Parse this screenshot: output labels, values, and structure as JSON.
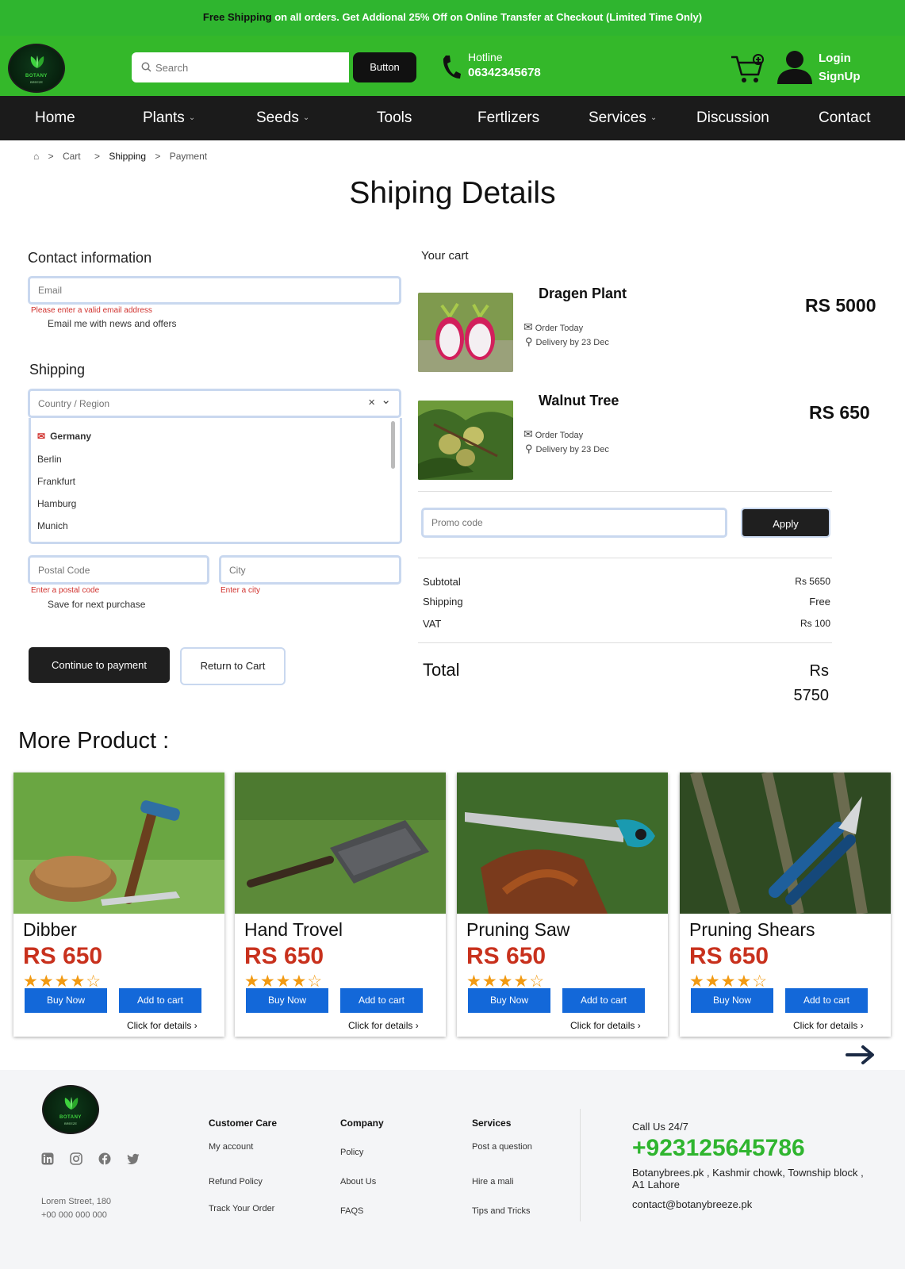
{
  "banner": {
    "highlight": "Free Shipping",
    "text": " on all orders. Get Addional 25% Off on Online Transfer at Checkout (Limited Time Only)"
  },
  "header": {
    "logo_text": "BOTANY",
    "logo_sub": "BREEZE",
    "search_placeholder": "Search",
    "search_button": "Button",
    "hotline_label": "Hotline",
    "hotline_number": "06342345678",
    "login": "Login",
    "signup": "SignUp"
  },
  "nav": {
    "items": [
      {
        "label": "Home"
      },
      {
        "label": "Plants",
        "dropdown": true
      },
      {
        "label": "Seeds",
        "dropdown": true
      },
      {
        "label": "Tools"
      },
      {
        "label": "Fertlizers"
      },
      {
        "label": "Services",
        "dropdown": true
      },
      {
        "label": "Discussion"
      },
      {
        "label": "Contact"
      }
    ]
  },
  "breadcrumb": [
    "Cart",
    "Shipping",
    "Payment"
  ],
  "page_title": "Shiping Details",
  "contact": {
    "heading": "Contact information",
    "email_placeholder": "Email",
    "email_error": "Please enter a valid email address",
    "newsletter_label": "Email me with news and offers"
  },
  "shipping": {
    "heading": "Shipping",
    "country_placeholder": "Country / Region",
    "dropdown_country": "Germany",
    "dropdown_cities": [
      "Berlin",
      "Frankfurt",
      "Hamburg",
      "Munich"
    ],
    "postal_placeholder": "Postal Code",
    "postal_error": "Enter a postal code",
    "city_placeholder": "City",
    "city_error": "Enter a city",
    "save_label": "Save for next purchase",
    "continue_button": "Continue to payment",
    "return_button": "Return to Cart"
  },
  "cart": {
    "heading": "Your cart",
    "items": [
      {
        "name": "Dragen Plant",
        "price": "RS 5000",
        "order": "Order Today",
        "delivery": "Delivery by 23 Dec"
      },
      {
        "name": "Walnut Tree",
        "price": "RS 650",
        "order": "Order Today",
        "delivery": "Delivery by 23 Dec"
      }
    ],
    "promo_placeholder": "Promo code",
    "apply_button": "Apply",
    "summary": [
      {
        "label": "Subtotal",
        "value": "Rs 5650"
      },
      {
        "label": "Shipping",
        "value": "Free"
      },
      {
        "label": "VAT",
        "value": "Rs 100"
      }
    ],
    "total_label": "Total",
    "total_currency": "Rs",
    "total_value": "5750"
  },
  "more": {
    "title": "More Product :",
    "products": [
      {
        "name": "Dibber",
        "price": "RS 650",
        "rating": 4,
        "stars": "★★★★☆",
        "buy": "Buy Now",
        "add": "Add to cart",
        "details": "Click for details"
      },
      {
        "name": "Hand Trovel",
        "price": "RS 650",
        "rating": 4,
        "stars": "★★★★☆",
        "buy": "Buy Now",
        "add": "Add to cart",
        "details": "Click for details"
      },
      {
        "name": "Pruning Saw",
        "price": "RS 650",
        "rating": 4,
        "stars": "★★★★☆",
        "buy": "Buy Now",
        "add": "Add to cart",
        "details": "Click for details"
      },
      {
        "name": "Pruning Shears",
        "price": "RS 650",
        "rating": 4,
        "stars": "★★★★☆",
        "buy": "Buy Now",
        "add": "Add to cart",
        "details": "Click for details"
      }
    ]
  },
  "footer": {
    "address_line1": "Lorem Street, 180",
    "address_line2": "+00 000 000 000",
    "columns": [
      {
        "heading": "Customer Care",
        "links": [
          "My account",
          "Refund Policy",
          "Track Your Order"
        ]
      },
      {
        "heading": "Company",
        "links": [
          "Policy",
          "About Us",
          "FAQS"
        ]
      },
      {
        "heading": "Services",
        "links": [
          "Post a question",
          "Hire a mali",
          "Tips and Tricks"
        ]
      }
    ],
    "call_label": "Call Us 24/7",
    "phone": "+923125645786",
    "address": "Botanybrees.pk , Kashmir chowk, Township block , A1 Lahore",
    "email": "contact@botanybreeze.pk"
  },
  "colors": {
    "brand_green": "#34b82a",
    "nav_dark": "#1b1b1b",
    "price_red": "#c8311d",
    "button_blue": "#1368d9",
    "phone_green": "#2fb52f"
  }
}
